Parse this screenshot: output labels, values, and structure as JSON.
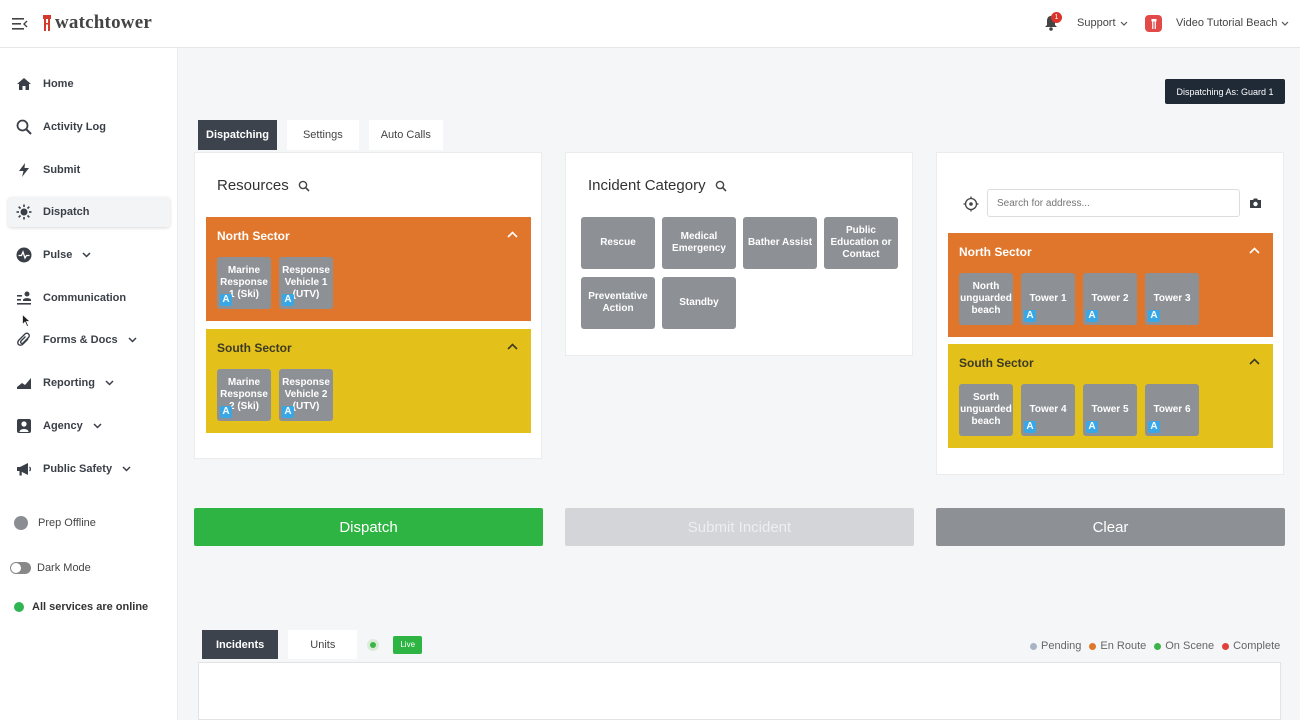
{
  "app": {
    "name": "watchtower"
  },
  "header": {
    "notifications_count": "1",
    "support_label": "Support",
    "agency_name": "Video Tutorial Beach"
  },
  "sidebar": {
    "items": [
      {
        "label": "Home",
        "icon": "home-icon"
      },
      {
        "label": "Activity Log",
        "icon": "search-icon"
      },
      {
        "label": "Submit",
        "icon": "bolt-icon"
      },
      {
        "label": "Dispatch",
        "icon": "sun-icon",
        "active": true
      },
      {
        "label": "Pulse",
        "icon": "pulse-icon",
        "has_dropdown": true
      },
      {
        "label": "Communication",
        "icon": "communication-icon"
      },
      {
        "label": "Forms & Docs",
        "icon": "paperclip-icon",
        "has_dropdown": true
      },
      {
        "label": "Reporting",
        "icon": "chart-icon",
        "has_dropdown": true
      },
      {
        "label": "Agency",
        "icon": "user-icon",
        "has_dropdown": true
      },
      {
        "label": "Public Safety",
        "icon": "megaphone-icon",
        "has_dropdown": true
      }
    ],
    "prep_offline": "Prep Offline",
    "dark_mode": "Dark Mode",
    "status": "All services are online"
  },
  "dispatching_as": "Dispatching As: Guard 1",
  "tabs": [
    "Dispatching",
    "Settings",
    "Auto Calls"
  ],
  "resources": {
    "title": "Resources",
    "sectors": [
      {
        "name": "North Sector",
        "color": "#e0762b",
        "units": [
          {
            "label": "Marine Response 1 (Ski)",
            "badge": "A"
          },
          {
            "label": "Response Vehicle 1 (UTV)",
            "badge": "A"
          }
        ]
      },
      {
        "name": "South Sector",
        "color": "#e3c11a",
        "units": [
          {
            "label": "Marine Response 2 (Ski)",
            "badge": "A"
          },
          {
            "label": "Response Vehicle 2 (UTV)",
            "badge": "A"
          }
        ]
      }
    ]
  },
  "incident_category": {
    "title": "Incident Category",
    "categories": [
      "Rescue",
      "Medical Emergency",
      "Bather Assist",
      "Public Education or Contact",
      "Preventative Action",
      "Standby"
    ]
  },
  "map": {
    "search_placeholder": "Search for address...",
    "sectors": [
      {
        "name": "North Sector",
        "color": "#e0762b",
        "locations": [
          {
            "label": "North unguarded beach",
            "badge": ""
          },
          {
            "label": "Tower 1",
            "badge": "A"
          },
          {
            "label": "Tower 2",
            "badge": "A"
          },
          {
            "label": "Tower 3",
            "badge": "A"
          }
        ]
      },
      {
        "name": "South Sector",
        "color": "#e3c11a",
        "locations": [
          {
            "label": "Sorth unguarded beach",
            "badge": ""
          },
          {
            "label": "Tower 4",
            "badge": "A"
          },
          {
            "label": "Tower 5",
            "badge": "A"
          },
          {
            "label": "Tower 6",
            "badge": "A"
          }
        ]
      }
    ]
  },
  "actions": {
    "dispatch": "Dispatch",
    "submit": "Submit Incident",
    "clear": "Clear"
  },
  "bottom": {
    "tabs": [
      "Incidents",
      "Units"
    ],
    "live": "Live",
    "legend": [
      {
        "label": "Pending",
        "color": "#a9b4c4"
      },
      {
        "label": "En Route",
        "color": "#e0762b"
      },
      {
        "label": "On Scene",
        "color": "#3bb54a"
      },
      {
        "label": "Complete",
        "color": "#e0413c"
      }
    ]
  },
  "colors": {
    "accent_dark": "#3c434c",
    "green": "#2db442",
    "badge_blue": "#39a6e6"
  }
}
